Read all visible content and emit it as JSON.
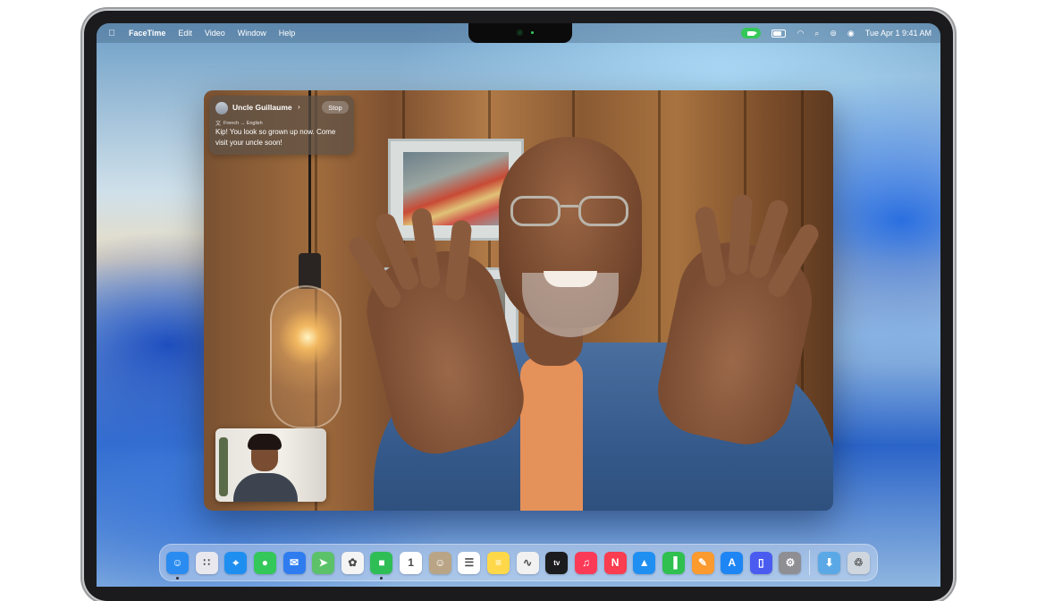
{
  "menubar": {
    "apple_glyph": "",
    "app_name": "FaceTime",
    "menus": [
      "Edit",
      "Video",
      "Window",
      "Help"
    ],
    "datetime": "Tue Apr 1  9:41 AM"
  },
  "call": {
    "caption": {
      "caller_name": "Uncle Guillaume",
      "chevron": "›",
      "stop_label": "Stop",
      "translation": "French → English",
      "message": "Kip! You look so grown up now. Come visit your uncle soon!"
    }
  },
  "dock": {
    "apps": [
      {
        "name": "finder-icon",
        "bg": "#2a8cf0",
        "glyph": "☺",
        "running": true
      },
      {
        "name": "launchpad-icon",
        "bg": "#e8e8ee",
        "glyph": "∷",
        "running": false
      },
      {
        "name": "safari-icon",
        "bg": "#1e8ff0",
        "glyph": "⌖",
        "running": false
      },
      {
        "name": "messages-icon",
        "bg": "#34c759",
        "glyph": "●",
        "running": false
      },
      {
        "name": "mail-icon",
        "bg": "#2f7cf0",
        "glyph": "✉",
        "running": false
      },
      {
        "name": "maps-icon",
        "bg": "#5cc26a",
        "glyph": "➤",
        "running": false
      },
      {
        "name": "photos-icon",
        "bg": "#f4f4f4",
        "glyph": "✿",
        "running": false
      },
      {
        "name": "facetime-icon",
        "bg": "#2fbd55",
        "glyph": "■",
        "running": true
      },
      {
        "name": "calendar-icon",
        "bg": "#ffffff",
        "glyph": "1",
        "running": false
      },
      {
        "name": "contacts-icon",
        "bg": "#b9a585",
        "glyph": "☺",
        "running": false
      },
      {
        "name": "reminders-icon",
        "bg": "#ffffff",
        "glyph": "☰",
        "running": false
      },
      {
        "name": "notes-icon",
        "bg": "#ffd84a",
        "glyph": "≡",
        "running": false
      },
      {
        "name": "freeform-icon",
        "bg": "#f1f1f1",
        "glyph": "∿",
        "running": false
      },
      {
        "name": "apple-tv-icon",
        "bg": "#1c1c1e",
        "glyph": "tv",
        "running": false
      },
      {
        "name": "music-icon",
        "bg": "#fb3a58",
        "glyph": "♫",
        "running": false
      },
      {
        "name": "news-icon",
        "bg": "#fa3d4f",
        "glyph": "N",
        "running": false
      },
      {
        "name": "keynote-icon",
        "bg": "#1f8ff2",
        "glyph": "▲",
        "running": false
      },
      {
        "name": "numbers-icon",
        "bg": "#2fc04f",
        "glyph": "▐",
        "running": false
      },
      {
        "name": "pages-icon",
        "bg": "#fb9a2e",
        "glyph": "✎",
        "running": false
      },
      {
        "name": "app-store-icon",
        "bg": "#1d86f4",
        "glyph": "A",
        "running": false
      },
      {
        "name": "iphone-mirroring-icon",
        "bg": "#4a5cf0",
        "glyph": "▯",
        "running": false
      },
      {
        "name": "system-settings-icon",
        "bg": "#8e8e93",
        "glyph": "⚙",
        "running": false
      }
    ],
    "extras": [
      {
        "name": "downloads-folder-icon",
        "bg": "#5aa9e6",
        "glyph": "⬇"
      },
      {
        "name": "trash-icon",
        "bg": "#cfd6de",
        "glyph": "♲"
      }
    ]
  }
}
